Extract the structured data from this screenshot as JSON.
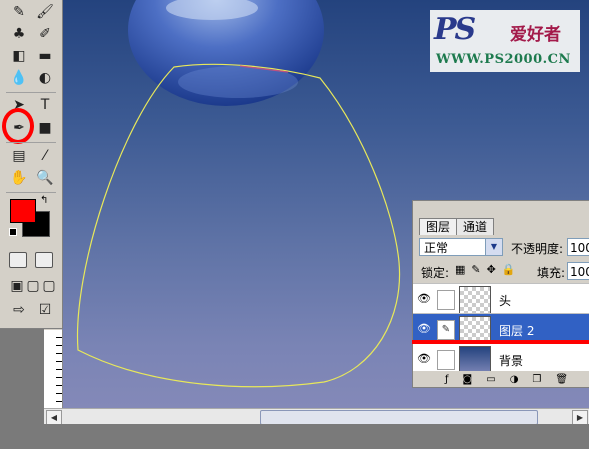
{
  "logo": {
    "brand": "PS",
    "chinese": "爱好者",
    "url": "WWW.PS2000.CN"
  },
  "toolbox": {
    "foreground_color": "#ff0000",
    "background_color": "#000000",
    "highlight_color": "#ff0000",
    "type_tool_glyph": "T"
  },
  "layers_panel": {
    "tabs": [
      {
        "label": "图层",
        "active": true
      },
      {
        "label": "通道",
        "active": false
      }
    ],
    "blend_mode": "正常",
    "opacity_label": "不透明度:",
    "opacity_value": "100",
    "lock_label": "锁定:",
    "fill_label": "填充:",
    "fill_value": "100",
    "layers": [
      {
        "name": "头",
        "selected": false,
        "visible": true
      },
      {
        "name": "图层 2",
        "selected": true,
        "visible": true
      },
      {
        "name": "背景",
        "selected": false,
        "visible": true
      }
    ]
  },
  "colors": {
    "selection_path": "#e8e85a",
    "selected_row": "#3161c4",
    "annotation": "#ff0000"
  }
}
